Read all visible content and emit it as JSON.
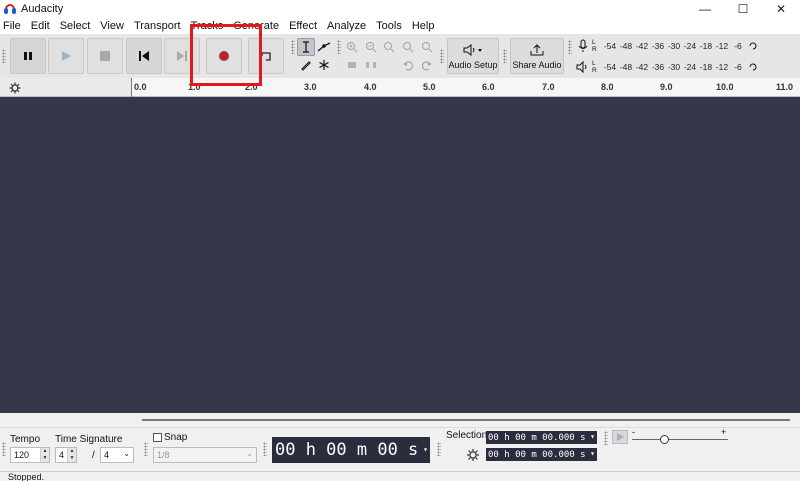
{
  "window": {
    "title": "Audacity",
    "minimize": "—",
    "maximize": "☐",
    "close": "✕"
  },
  "menu": [
    "File",
    "Edit",
    "Select",
    "View",
    "Transport",
    "Tracks",
    "Generate",
    "Effect",
    "Analyze",
    "Tools",
    "Help"
  ],
  "toolbar": {
    "audio_setup_label": "Audio Setup",
    "share_audio_label": "Share Audio"
  },
  "meters": {
    "record_channels": [
      "L",
      "R"
    ],
    "play_channels": [
      "L",
      "R"
    ],
    "scale": [
      "-54",
      "-48",
      "-42",
      "-36",
      "-30",
      "-24",
      "-18",
      "-12",
      "-6"
    ]
  },
  "ruler": {
    "ticks": [
      "0.0",
      "1.0",
      "2.0",
      "3.0",
      "4.0",
      "5.0",
      "6.0",
      "7.0",
      "8.0",
      "9.0",
      "10.0",
      "11.0"
    ]
  },
  "bottom": {
    "tempo_label": "Tempo",
    "tempo_value": "120",
    "time_signature_label": "Time Signature",
    "time_sig_numerator": "4",
    "time_sig_separator": "/",
    "time_sig_denominator": "4",
    "snap_label": "Snap",
    "snap_value": "1/8",
    "time_display": "00 h 00 m 00 s",
    "selection_label": "Selection",
    "selection_start": "00 h 00 m 00.000 s",
    "selection_end": "00 h 00 m 00.000 s",
    "speed_minus": "-",
    "speed_plus": "+"
  },
  "status": {
    "text": "Stopped."
  },
  "colors": {
    "track_background": "#343849",
    "highlight": "#e01a1a",
    "record_red": "#b3292b"
  }
}
